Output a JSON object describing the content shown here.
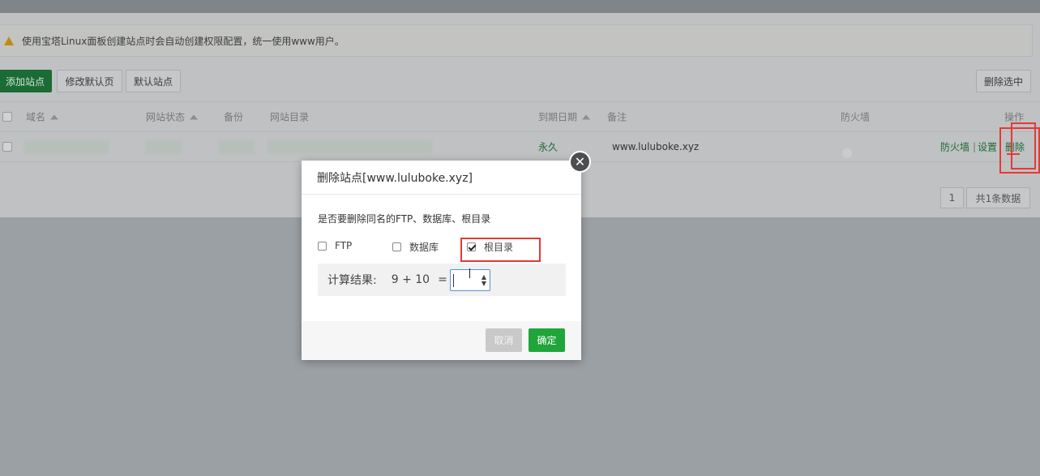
{
  "notice": {
    "text": "使用宝塔Linux面板创建站点时会自动创建权限配置，统一使用www用户。"
  },
  "toolbar": {
    "add_site": "添加站点",
    "edit_default_page": "修改默认页",
    "default_site": "默认站点",
    "delete_selected": "删除选中"
  },
  "table": {
    "headers": {
      "domain": "域名",
      "status": "网站状态",
      "backup": "备份",
      "root": "网站目录",
      "expire": "到期日期",
      "note": "备注",
      "firewall": "防火墙",
      "action": "操作"
    },
    "rows": [
      {
        "expire": "永久",
        "note": "www.luluboke.xyz",
        "firewall_enabled": false,
        "actions": {
          "firewall": "防火墙",
          "sep": "|",
          "settings": "设置",
          "delete": "删除"
        }
      }
    ]
  },
  "pagination": {
    "page": "1",
    "total": "共1条数据"
  },
  "modal": {
    "title": "删除站点[www.luluboke.xyz]",
    "question": "是否要删除同名的FTP、数据库、根目录",
    "options": [
      {
        "label": "FTP",
        "checked": false
      },
      {
        "label": "数据库",
        "checked": false
      },
      {
        "label": "根目录",
        "checked": true
      }
    ],
    "calc_label": "计算结果:",
    "calc_expr": "9 + 10",
    "calc_eq": "=",
    "answer_value": "",
    "cancel": "取消",
    "confirm": "确定"
  },
  "colors": {
    "primary_green": "#20a53a",
    "highlight_red": "#e53935"
  }
}
